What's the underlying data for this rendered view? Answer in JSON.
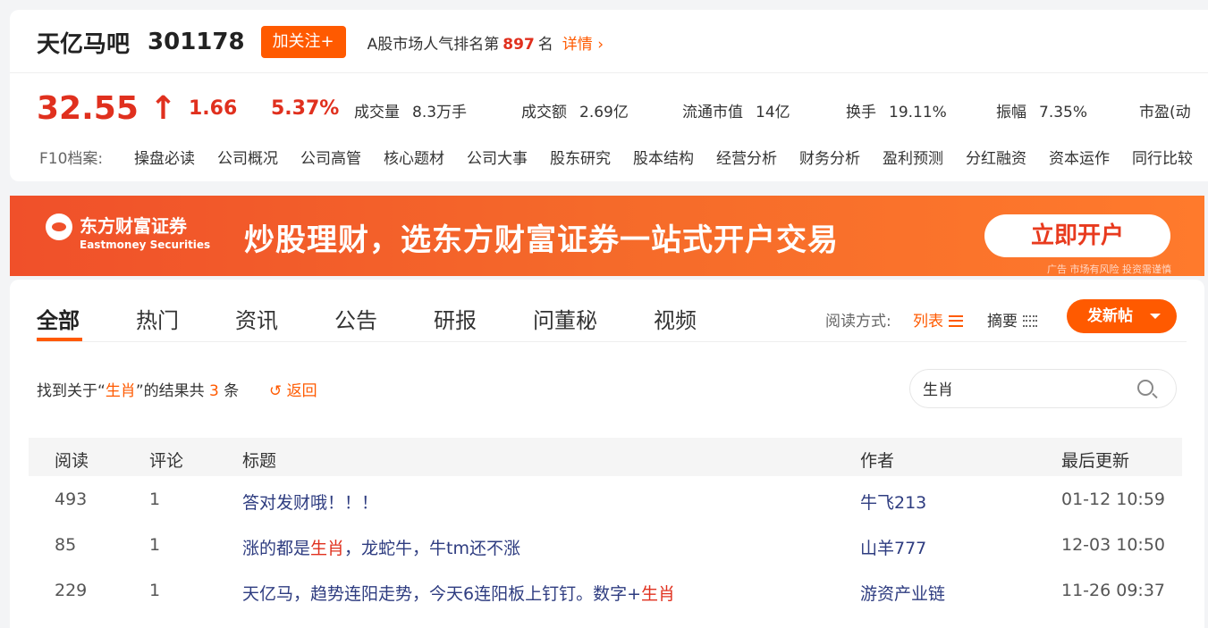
{
  "header": {
    "bar_name": "天亿马吧",
    "stock_code": "301178",
    "follow_label": "加关注+",
    "rank_prefix": "A股市场人气排名第",
    "rank_value": "897",
    "rank_suffix": "名",
    "detail_label": "详情"
  },
  "quote": {
    "price": "32.55",
    "arrow": "↑",
    "change": "1.66",
    "change_pct": "5.37%",
    "stats": [
      {
        "label": "成交量",
        "value": "8.3万手"
      },
      {
        "label": "成交额",
        "value": "2.69亿"
      },
      {
        "label": "流通市值",
        "value": "14亿"
      },
      {
        "label": "换手",
        "value": "19.11%"
      },
      {
        "label": "振幅",
        "value": "7.35%"
      },
      {
        "label": "市盈(动",
        "value": ""
      }
    ]
  },
  "f10": {
    "label": "F10档案:",
    "links": [
      "操盘必读",
      "公司概况",
      "公司高管",
      "核心题材",
      "公司大事",
      "股东研究",
      "股本结构",
      "经营分析",
      "财务分析",
      "盈利预测",
      "分红融资",
      "资本运作",
      "同行比较"
    ]
  },
  "banner": {
    "brand": "东方财富证券",
    "brand_en": "Eastmoney Securities",
    "slogan": "炒股理财，选东方财富证券一站式开户交易",
    "cta": "立即开户",
    "ad_note": "广告 市场有风险 投资需谨慎"
  },
  "tabs": [
    "全部",
    "热门",
    "资讯",
    "公告",
    "研报",
    "问董秘",
    "视频"
  ],
  "read_mode": {
    "label": "阅读方式:",
    "list": "列表",
    "summary": "摘要"
  },
  "post_button": "发新帖",
  "search": {
    "result_prefix": "找到关于“",
    "keyword": "生肖",
    "result_middle": "”的结果共",
    "count": "3",
    "result_suffix": "条",
    "back_label": "返回",
    "input_value": "生肖"
  },
  "table": {
    "headers": [
      "阅读",
      "评论",
      "标题",
      "作者",
      "最后更新"
    ],
    "rows": [
      {
        "reads": "493",
        "comments": "1",
        "title_pre": "答对发财哦！！！",
        "title_hl": "",
        "title_post": "",
        "author": "牛飞213",
        "updated": "01-12 10:59"
      },
      {
        "reads": "85",
        "comments": "1",
        "title_pre": "涨的都是",
        "title_hl": "生肖",
        "title_post": "，龙蛇牛，牛tm还不涨",
        "author": "山羊777",
        "updated": "12-03 10:50"
      },
      {
        "reads": "229",
        "comments": "1",
        "title_pre": "天亿马，趋势连阳走势，今天6连阳板上钉钉。数字+",
        "title_hl": "生肖",
        "title_post": "",
        "author": "游资产业链",
        "updated": "11-26 09:37"
      }
    ]
  },
  "colors": {
    "accent": "#ff5a00",
    "up": "#e0301e",
    "link": "#2e3c80"
  }
}
